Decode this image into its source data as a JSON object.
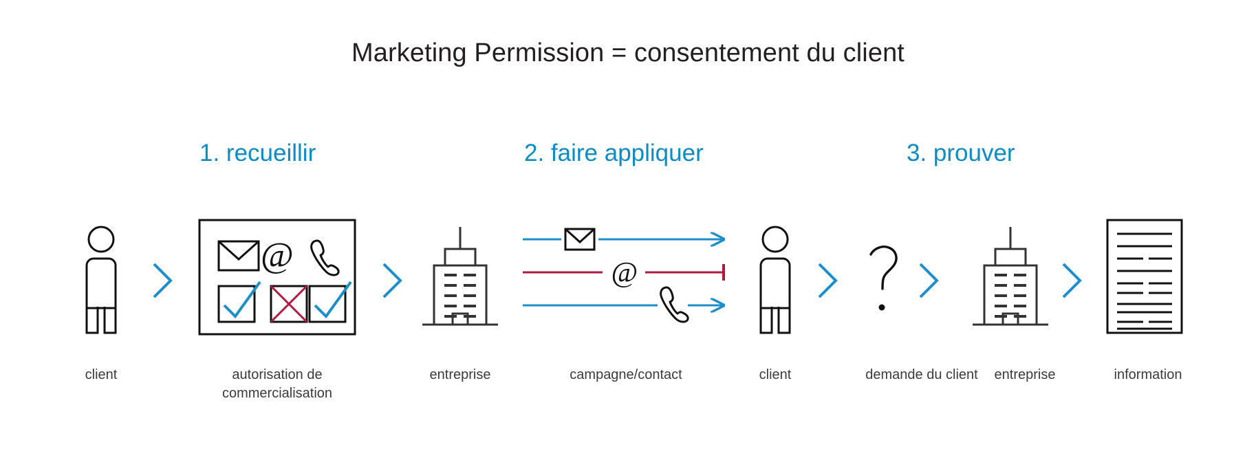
{
  "page": {
    "title": "Marketing Permission = consentement du client",
    "background_color": "#ffffff",
    "accent_blue": "#0b8cc6",
    "accent_red": "#b01a3e",
    "ink": "#231f20"
  },
  "steps": [
    {
      "id": "step-1",
      "label": "1. recueillir"
    },
    {
      "id": "step-2",
      "label": "2. faire appliquer"
    },
    {
      "id": "step-3",
      "label": "3. prouver"
    }
  ],
  "nodes": [
    {
      "id": "client-1",
      "icon": "person-icon",
      "caption": "client"
    },
    {
      "id": "permission-box",
      "icon": "permission-box-icon",
      "caption": "autorisation de\ncommercialisation"
    },
    {
      "id": "company-1",
      "icon": "building-icon",
      "caption": "entreprise"
    },
    {
      "id": "campaign",
      "icon": "campaign-channels-icon",
      "caption": "campagne/contact"
    },
    {
      "id": "client-2",
      "icon": "person-icon",
      "caption": "client"
    },
    {
      "id": "request",
      "icon": "question-mark-icon",
      "caption": "demande du client"
    },
    {
      "id": "company-2",
      "icon": "building-icon",
      "caption": "entreprise"
    },
    {
      "id": "information",
      "icon": "document-icon",
      "caption": "information"
    }
  ],
  "connectors": [
    {
      "id": "chevron-1",
      "icon": "chevron-right-icon",
      "color": "#0b8cc6"
    },
    {
      "id": "chevron-2",
      "icon": "chevron-right-icon",
      "color": "#0b8cc6"
    },
    {
      "id": "chevron-3",
      "icon": "chevron-right-icon",
      "color": "#0b8cc6"
    },
    {
      "id": "chevron-4",
      "icon": "chevron-right-icon",
      "color": "#0b8cc6"
    },
    {
      "id": "chevron-5",
      "icon": "chevron-right-icon",
      "color": "#0b8cc6"
    }
  ],
  "permission_box": {
    "channels": [
      {
        "id": "channel-mail",
        "icon": "envelope-icon",
        "glyph": "envelope"
      },
      {
        "id": "channel-email",
        "icon": "at-sign-icon",
        "glyph": "@"
      },
      {
        "id": "channel-phone",
        "icon": "phone-icon",
        "glyph": "phone"
      }
    ],
    "consents": [
      {
        "id": "consent-mail",
        "icon": "checkbox-checked-icon",
        "state": "allowed",
        "mark": "check",
        "color": "#0b8cc6"
      },
      {
        "id": "consent-email",
        "icon": "checkbox-crossed-icon",
        "state": "denied",
        "mark": "cross",
        "color": "#b01a3e"
      },
      {
        "id": "consent-phone",
        "icon": "checkbox-checked-icon",
        "state": "allowed",
        "mark": "check",
        "color": "#0b8cc6"
      }
    ]
  },
  "campaign_channels": [
    {
      "id": "campaign-mail",
      "icon": "envelope-icon",
      "state": "delivered",
      "line_color": "#0b8cc6",
      "end": "arrow"
    },
    {
      "id": "campaign-email",
      "icon": "at-sign-icon",
      "state": "blocked",
      "line_color": "#b01a3e",
      "end": "stop-bar"
    },
    {
      "id": "campaign-phone",
      "icon": "phone-icon",
      "state": "delivered",
      "line_color": "#0b8cc6",
      "end": "arrow"
    }
  ],
  "document": {
    "id": "information-document",
    "line_count": 10
  }
}
